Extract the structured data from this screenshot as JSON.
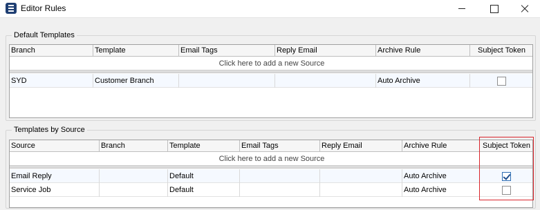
{
  "window": {
    "title": "Editor Rules"
  },
  "default_templates": {
    "label": "Default Templates",
    "columns": [
      "Branch",
      "Template",
      "Email Tags",
      "Reply Email",
      "Archive Rule",
      "Subject Token"
    ],
    "add_row_text": "Click here to add a new Source",
    "rows": [
      {
        "branch": "SYD",
        "template": "Customer Branch",
        "email_tags": "",
        "reply_email": "",
        "archive_rule": "Auto Archive",
        "subject_token": false
      }
    ]
  },
  "templates_by_source": {
    "label": "Templates by Source",
    "columns": [
      "Source",
      "Branch",
      "Template",
      "Email Tags",
      "Reply Email",
      "Archive Rule",
      "Subject Token"
    ],
    "add_row_text": "Click here to add a new Source",
    "rows": [
      {
        "source": "Email Reply",
        "branch": "",
        "template": "Default",
        "email_tags": "",
        "reply_email": "",
        "archive_rule": "Auto Archive",
        "subject_token": true
      },
      {
        "source": "Service Job",
        "branch": "",
        "template": "Default",
        "email_tags": "",
        "reply_email": "",
        "archive_rule": "Auto Archive",
        "subject_token": false
      }
    ]
  },
  "colors": {
    "highlight": "#d9242b",
    "grid_border": "#a0a0a0",
    "window_bg": "#f0f0f0"
  }
}
